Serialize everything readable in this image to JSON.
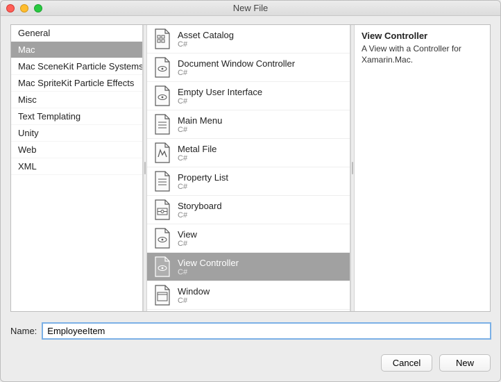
{
  "window": {
    "title": "New File"
  },
  "categories": [
    {
      "label": "General",
      "selected": false
    },
    {
      "label": "Mac",
      "selected": true
    },
    {
      "label": "Mac SceneKit Particle Systems",
      "selected": false
    },
    {
      "label": "Mac SpriteKit Particle Effects",
      "selected": false
    },
    {
      "label": "Misc",
      "selected": false
    },
    {
      "label": "Text Templating",
      "selected": false
    },
    {
      "label": "Unity",
      "selected": false
    },
    {
      "label": "Web",
      "selected": false
    },
    {
      "label": "XML",
      "selected": false
    }
  ],
  "templates": [
    {
      "label": "Asset Catalog",
      "sub": "C#",
      "icon": "grid",
      "selected": false
    },
    {
      "label": "Document Window Controller",
      "sub": "C#",
      "icon": "eye",
      "selected": false
    },
    {
      "label": "Empty User Interface",
      "sub": "C#",
      "icon": "eye",
      "selected": false
    },
    {
      "label": "Main Menu",
      "sub": "C#",
      "icon": "list",
      "selected": false
    },
    {
      "label": "Metal File",
      "sub": "C#",
      "icon": "metal",
      "selected": false
    },
    {
      "label": "Property List",
      "sub": "C#",
      "icon": "list",
      "selected": false
    },
    {
      "label": "Storyboard",
      "sub": "C#",
      "icon": "storyboard",
      "selected": false
    },
    {
      "label": "View",
      "sub": "C#",
      "icon": "eye",
      "selected": false
    },
    {
      "label": "View Controller",
      "sub": "C#",
      "icon": "eye",
      "selected": true
    },
    {
      "label": "Window",
      "sub": "C#",
      "icon": "window",
      "selected": false
    }
  ],
  "detail": {
    "title": "View Controller",
    "description": "A View with a Controller for Xamarin.Mac."
  },
  "nameField": {
    "label": "Name:",
    "value": "EmployeeItem"
  },
  "buttons": {
    "cancel": "Cancel",
    "new": "New"
  }
}
